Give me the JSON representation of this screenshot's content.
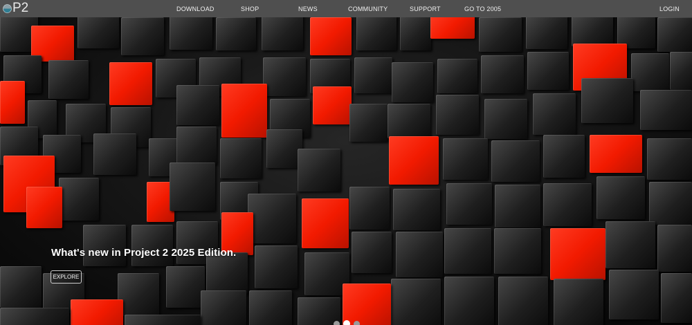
{
  "brand": {
    "logo_text": "P2"
  },
  "nav": {
    "download": "DOWNLOAD",
    "shop": "SHOP",
    "news": "NEWS",
    "community": "COMMUNITY",
    "support": "SUPPORT",
    "go_to_2005": "GO TO 2005",
    "login": "LOGIN"
  },
  "hero": {
    "headline": "What's new in Project 2 2025 Edition.",
    "cta_label": "EXPLORE",
    "carousel": {
      "slide_count": 3,
      "active_index": 1
    }
  },
  "colors": {
    "topbar": "#4f4f4f",
    "accent_red": "#f21a00",
    "logo_dot": "#3a8aa0"
  }
}
